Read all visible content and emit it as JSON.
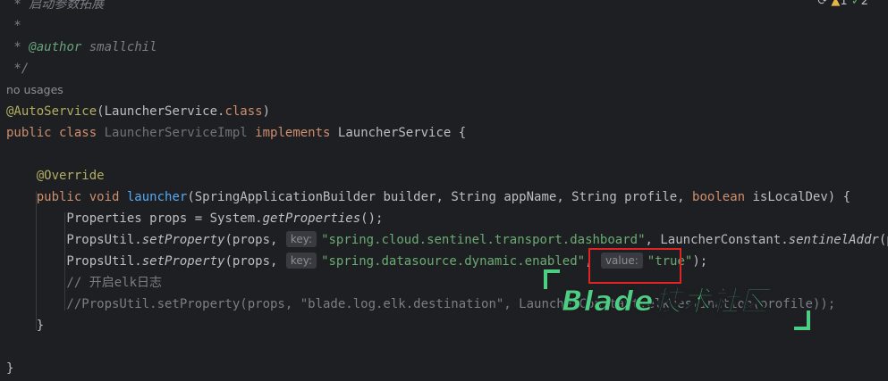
{
  "editor": {
    "lines": {
      "doc_title": " * 启动参数拓展",
      "doc_blank": " *",
      "doc_author_prefix": " * ",
      "doc_author_tag": "@author",
      "doc_author_name": " smallchil",
      "doc_end": " */",
      "no_usages": "no usages",
      "annotation": "@AutoService",
      "annotation_arg_open": "(LauncherService.",
      "annotation_arg_kw": "class",
      "annotation_arg_close": ")",
      "class_public": "public",
      "class_kw": " class ",
      "class_name": "LauncherServiceImpl",
      "class_implements": " implements ",
      "class_iface": "LauncherService {",
      "override": "    @Override",
      "method_public": "    public",
      "method_void": " void ",
      "method_name": "launcher",
      "method_params_1": "(SpringApplicationBuilder builder, String appName, String profile, ",
      "method_boolean": "boolean",
      "method_params_2": " isLocalDev) {",
      "props_decl_1": "        Properties props = System.",
      "props_decl_fn": "getProperties",
      "props_decl_2": "();",
      "call1_a": "        PropsUtil.",
      "call1_fn": "setProperty",
      "call1_b": "(props, ",
      "call1_key_hint": "key:",
      "call1_key": "\"spring.cloud.sentinel.transport.dashboard\"",
      "call1_c": ", LauncherConstant.",
      "call1_fn2": "sentinelAddr",
      "call1_d": "(profile",
      "call2_a": "        PropsUtil.",
      "call2_fn": "setProperty",
      "call2_b": "(props, ",
      "call2_key_hint": "key:",
      "call2_key": "\"spring.datasource.dynamic.enabled\"",
      "call2_c": ", ",
      "call2_value_hint": "value:",
      "call2_value": "\"true\"",
      "call2_d": ");",
      "comment_elk": "        // 开启elk日志",
      "comment_call": "        //PropsUtil.setProperty(props, \"blade.log.elk.destination\", LauncherConstant.elkDestination(profile));",
      "method_close": "    }",
      "class_close": "}"
    },
    "watermark_text": "Blade技术社区",
    "top_icons": {
      "warnings": "1",
      "checks": "2"
    }
  },
  "colors": {
    "background": "#1e1f22",
    "keyword": "#cf8e6d",
    "string": "#6aab73",
    "function": "#56a8f5",
    "annotation": "#b3ae60",
    "comment": "#7a7e85",
    "highlight_box": "#e02323",
    "watermark": "#4dcf83"
  }
}
